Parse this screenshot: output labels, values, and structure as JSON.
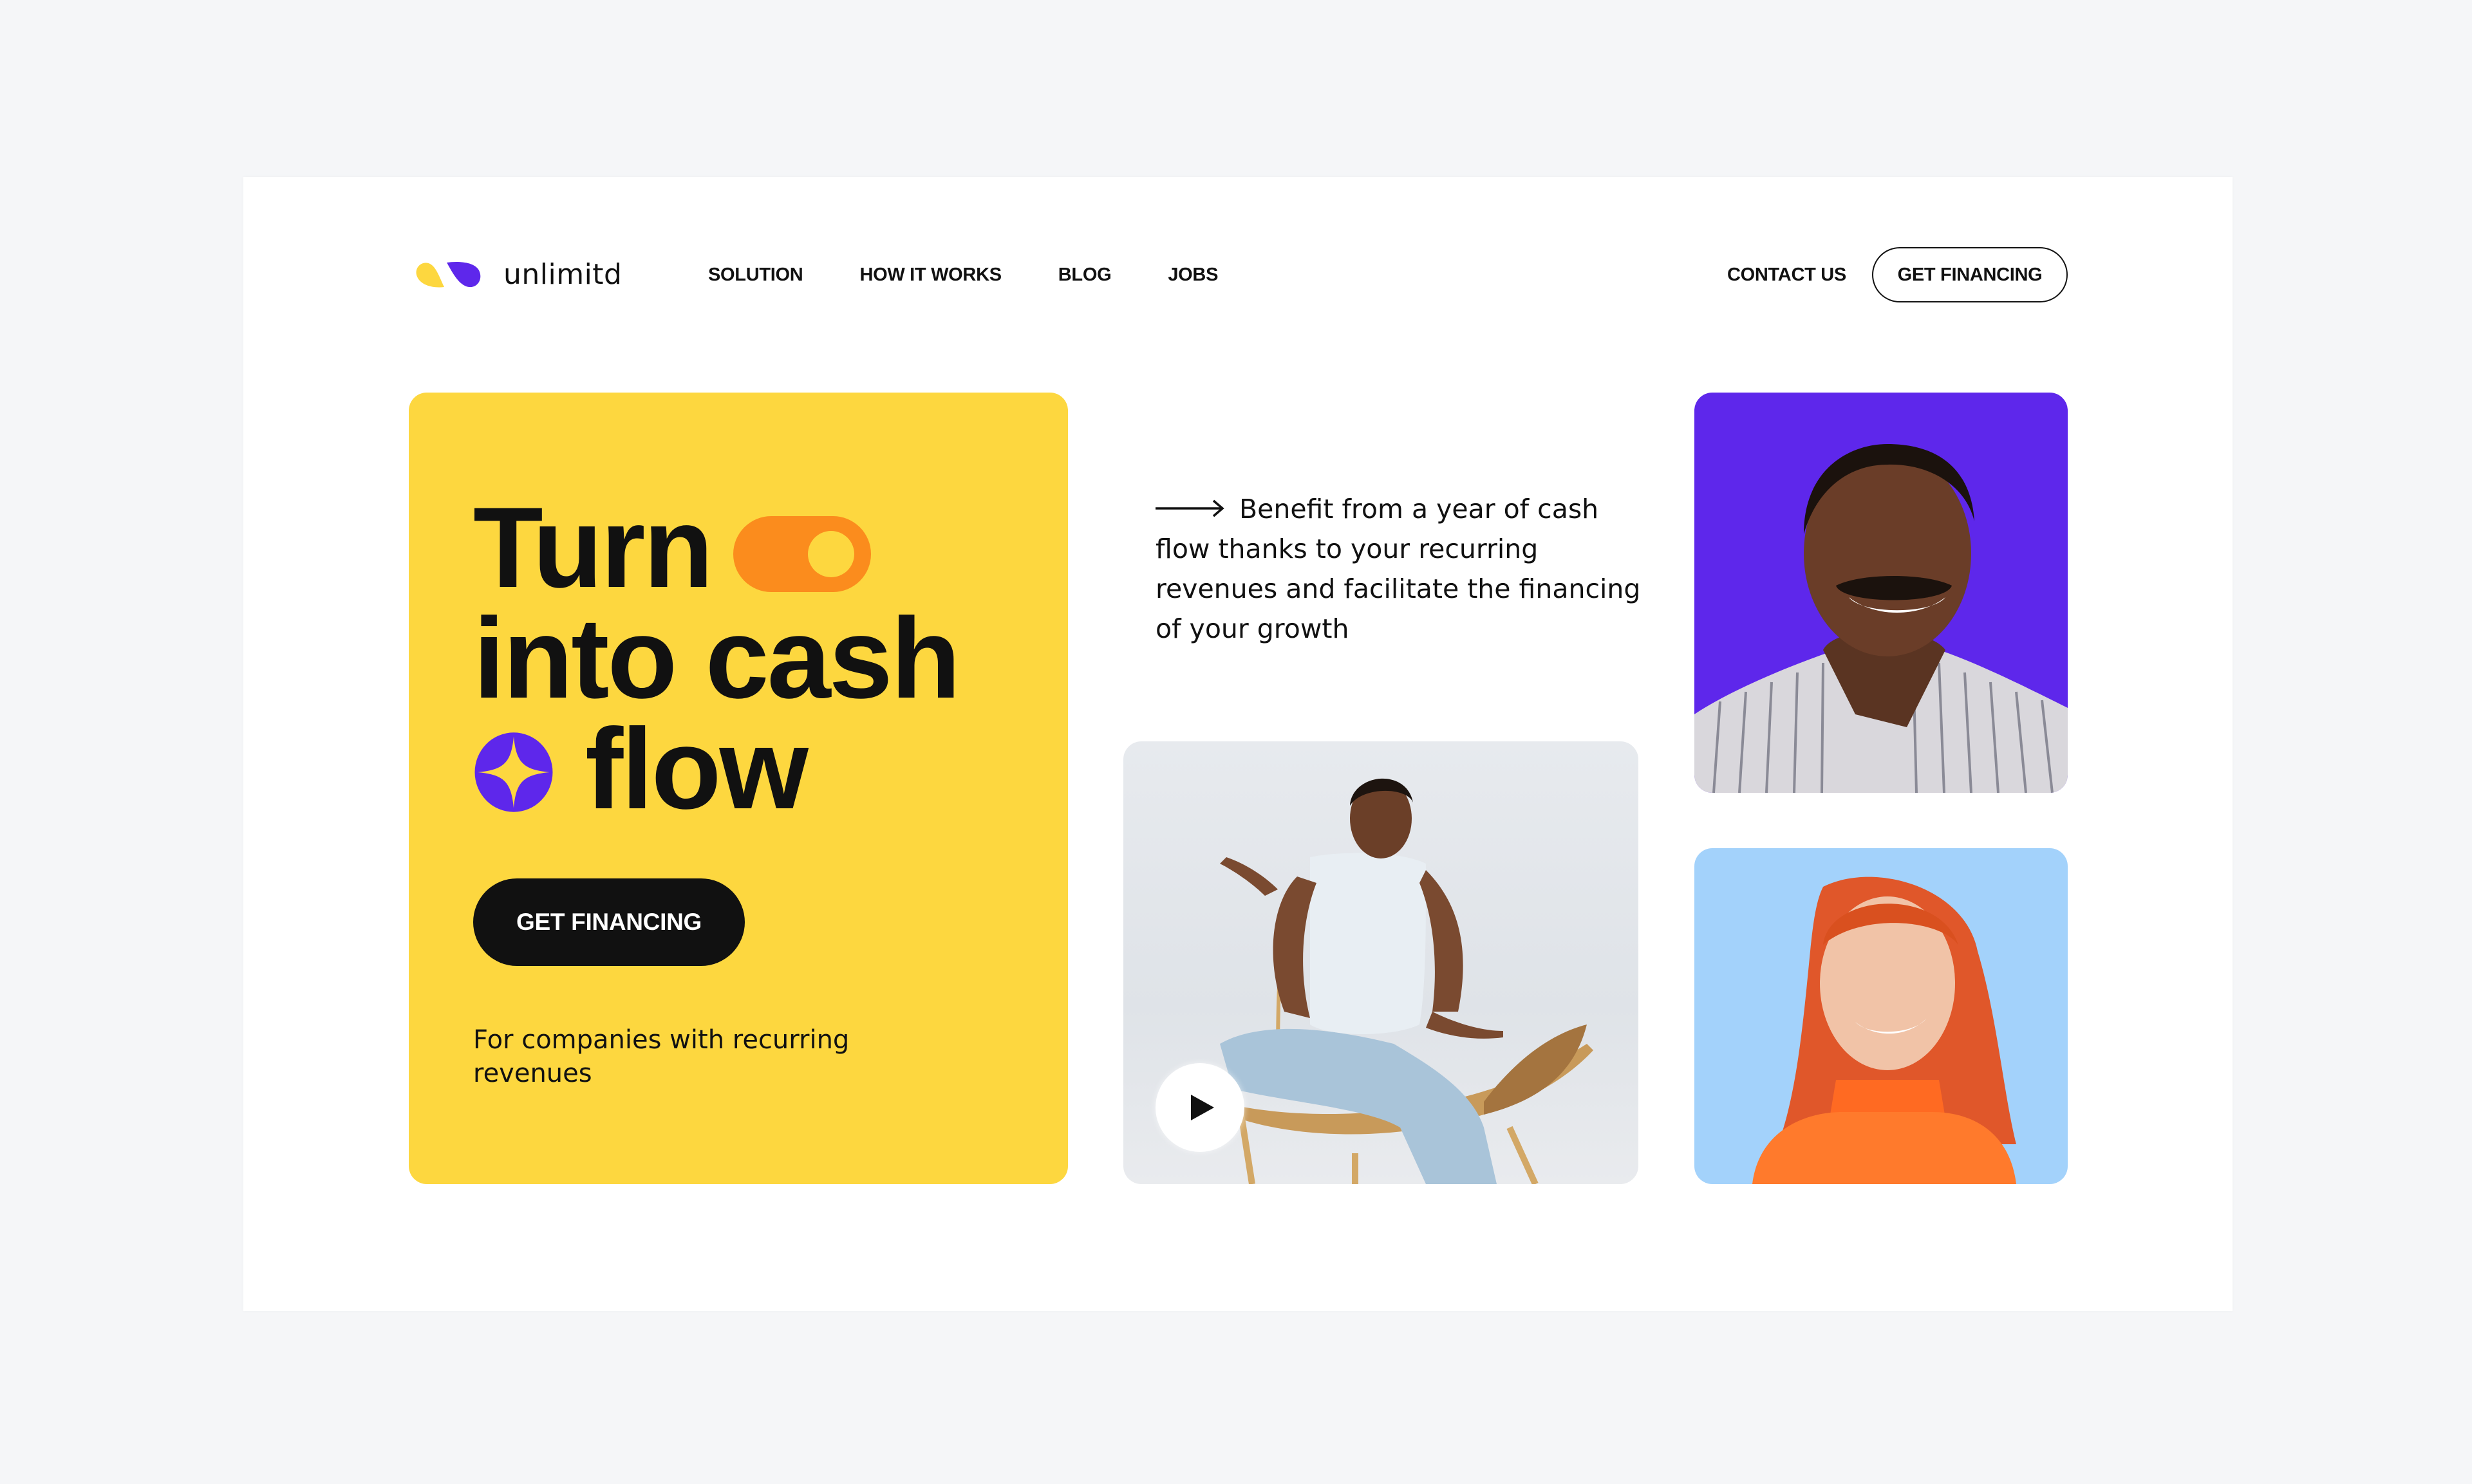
{
  "brand": {
    "name": "unlimitd",
    "logo_icon": "two-petal-logo-icon",
    "colors": {
      "yellow": "#fdd73f",
      "purple": "#5e27eb",
      "orange": "#fb8c1d",
      "light_blue": "#a3d2fb",
      "ink": "#111111",
      "page_bg": "#f5f6f8"
    }
  },
  "nav": {
    "items": [
      {
        "label": "SOLUTION"
      },
      {
        "label": "HOW IT WORKS"
      },
      {
        "label": "BLOG"
      },
      {
        "label": "JOBS"
      }
    ],
    "contact_label": "CONTACT US",
    "cta_label": "GET FINANCING"
  },
  "hero": {
    "headline_lines": [
      "Turn",
      "into cash",
      "flow"
    ],
    "toggle_icon": "toggle-switch-icon",
    "sparkle_icon": "sparkle-star-icon",
    "cta_label": "GET FINANCING",
    "subtitle": "For companies with recurring revenues"
  },
  "benefit": {
    "arrow_icon": "arrow-right-icon",
    "text": "Benefit from a year of cash flow thanks to your recurring revenues and facilitate the financing of your growth"
  },
  "media": {
    "video": {
      "description": "woman seated cross-legged on a wooden chair",
      "play_icon": "play-icon"
    },
    "portraits": [
      {
        "description": "smiling man in striped shirt on purple background"
      },
      {
        "description": "smiling red-haired woman in orange turtleneck on light blue background"
      }
    ]
  }
}
